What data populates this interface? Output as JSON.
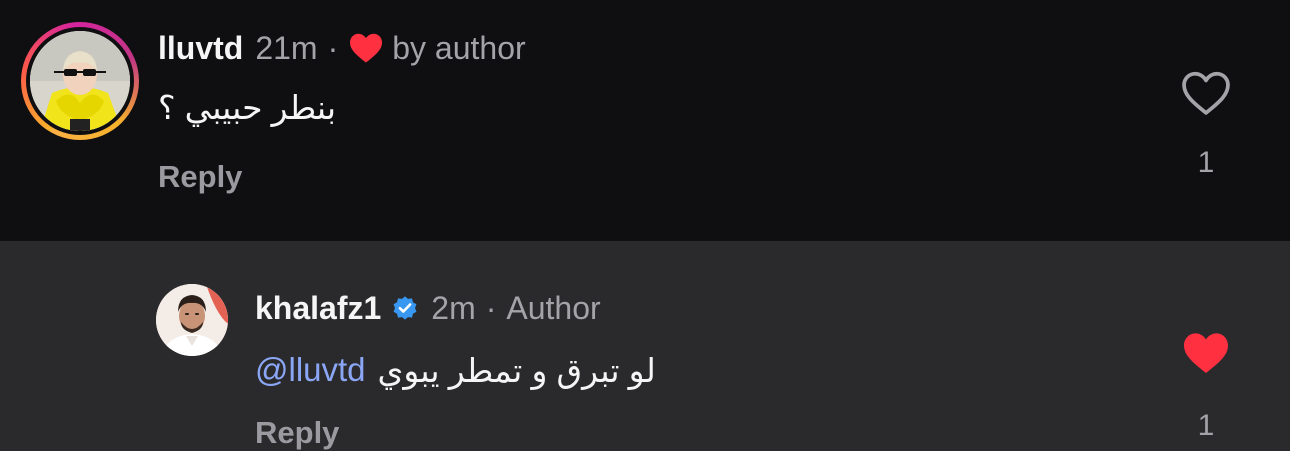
{
  "comments": [
    {
      "username": "lluvtd",
      "time": "21m",
      "separator": "·",
      "meta_label": "by author",
      "text": "بنطر حبيبي ؟",
      "reply_label": "Reply",
      "like_count": "1",
      "liked": false,
      "liked_by_author": true,
      "avatar_icon": "user-avatar-yellow-outfit",
      "has_story_ring": true
    },
    {
      "username": "khalafz1",
      "verified": true,
      "time": "2m",
      "separator": "·",
      "meta_label": "Author",
      "mention": "@lluvtd",
      "text": "لو تبرق و تمطر يبوي",
      "reply_label": "Reply",
      "like_count": "1",
      "liked": true,
      "avatar_icon": "user-avatar-man"
    }
  ],
  "colors": {
    "background_top": "#0f0f12",
    "background_reply": "#2a2a2d",
    "heart_red": "#ff3040",
    "mention_blue": "#8ba6f5",
    "verified_blue": "#3897f0"
  }
}
